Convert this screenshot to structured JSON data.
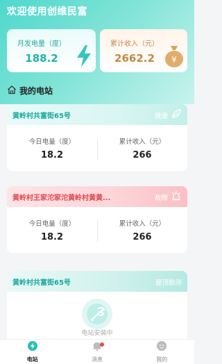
{
  "app": {
    "title": "欢迎使用创维民富"
  },
  "stats": {
    "monthly_power": {
      "label": "月发电量（度）",
      "value": "188.2"
    },
    "total_income": {
      "label": "累计收入（元）",
      "value": "2662.2"
    }
  },
  "section": {
    "title": "我的电站"
  },
  "stations": [
    {
      "name": "黄岭村共富街65号",
      "status": "健康",
      "today_label": "今日电量（度）",
      "today_value": "18.2",
      "income_label": "累计收入（元）",
      "income_value": "266"
    },
    {
      "name": "黄岭村王家沱家沱黄岭村黄黄...",
      "status": "故障",
      "today_label": "今日电量（度）",
      "today_value": "18.2",
      "income_label": "累计收入（元）",
      "income_value": "266"
    },
    {
      "name": "黄岭村共富街65号",
      "status": "屋顶勘测",
      "empty_text": "电站安装中"
    }
  ],
  "tabbar": [
    {
      "label": "电站",
      "active": true
    },
    {
      "label": "消息",
      "badge": true
    },
    {
      "label": "我的"
    }
  ],
  "colors": {
    "accent": "#21b3a8",
    "income": "#c18a47",
    "fault": "#e2464f"
  },
  "icons": {
    "lightning": "lightning-icon",
    "money_bag": "money-bag-icon",
    "home": "home-icon",
    "leaf": "leaf-icon",
    "alarm": "alarm-icon",
    "wrench": "wrench-icon",
    "message": "message-icon",
    "user": "user-icon"
  }
}
